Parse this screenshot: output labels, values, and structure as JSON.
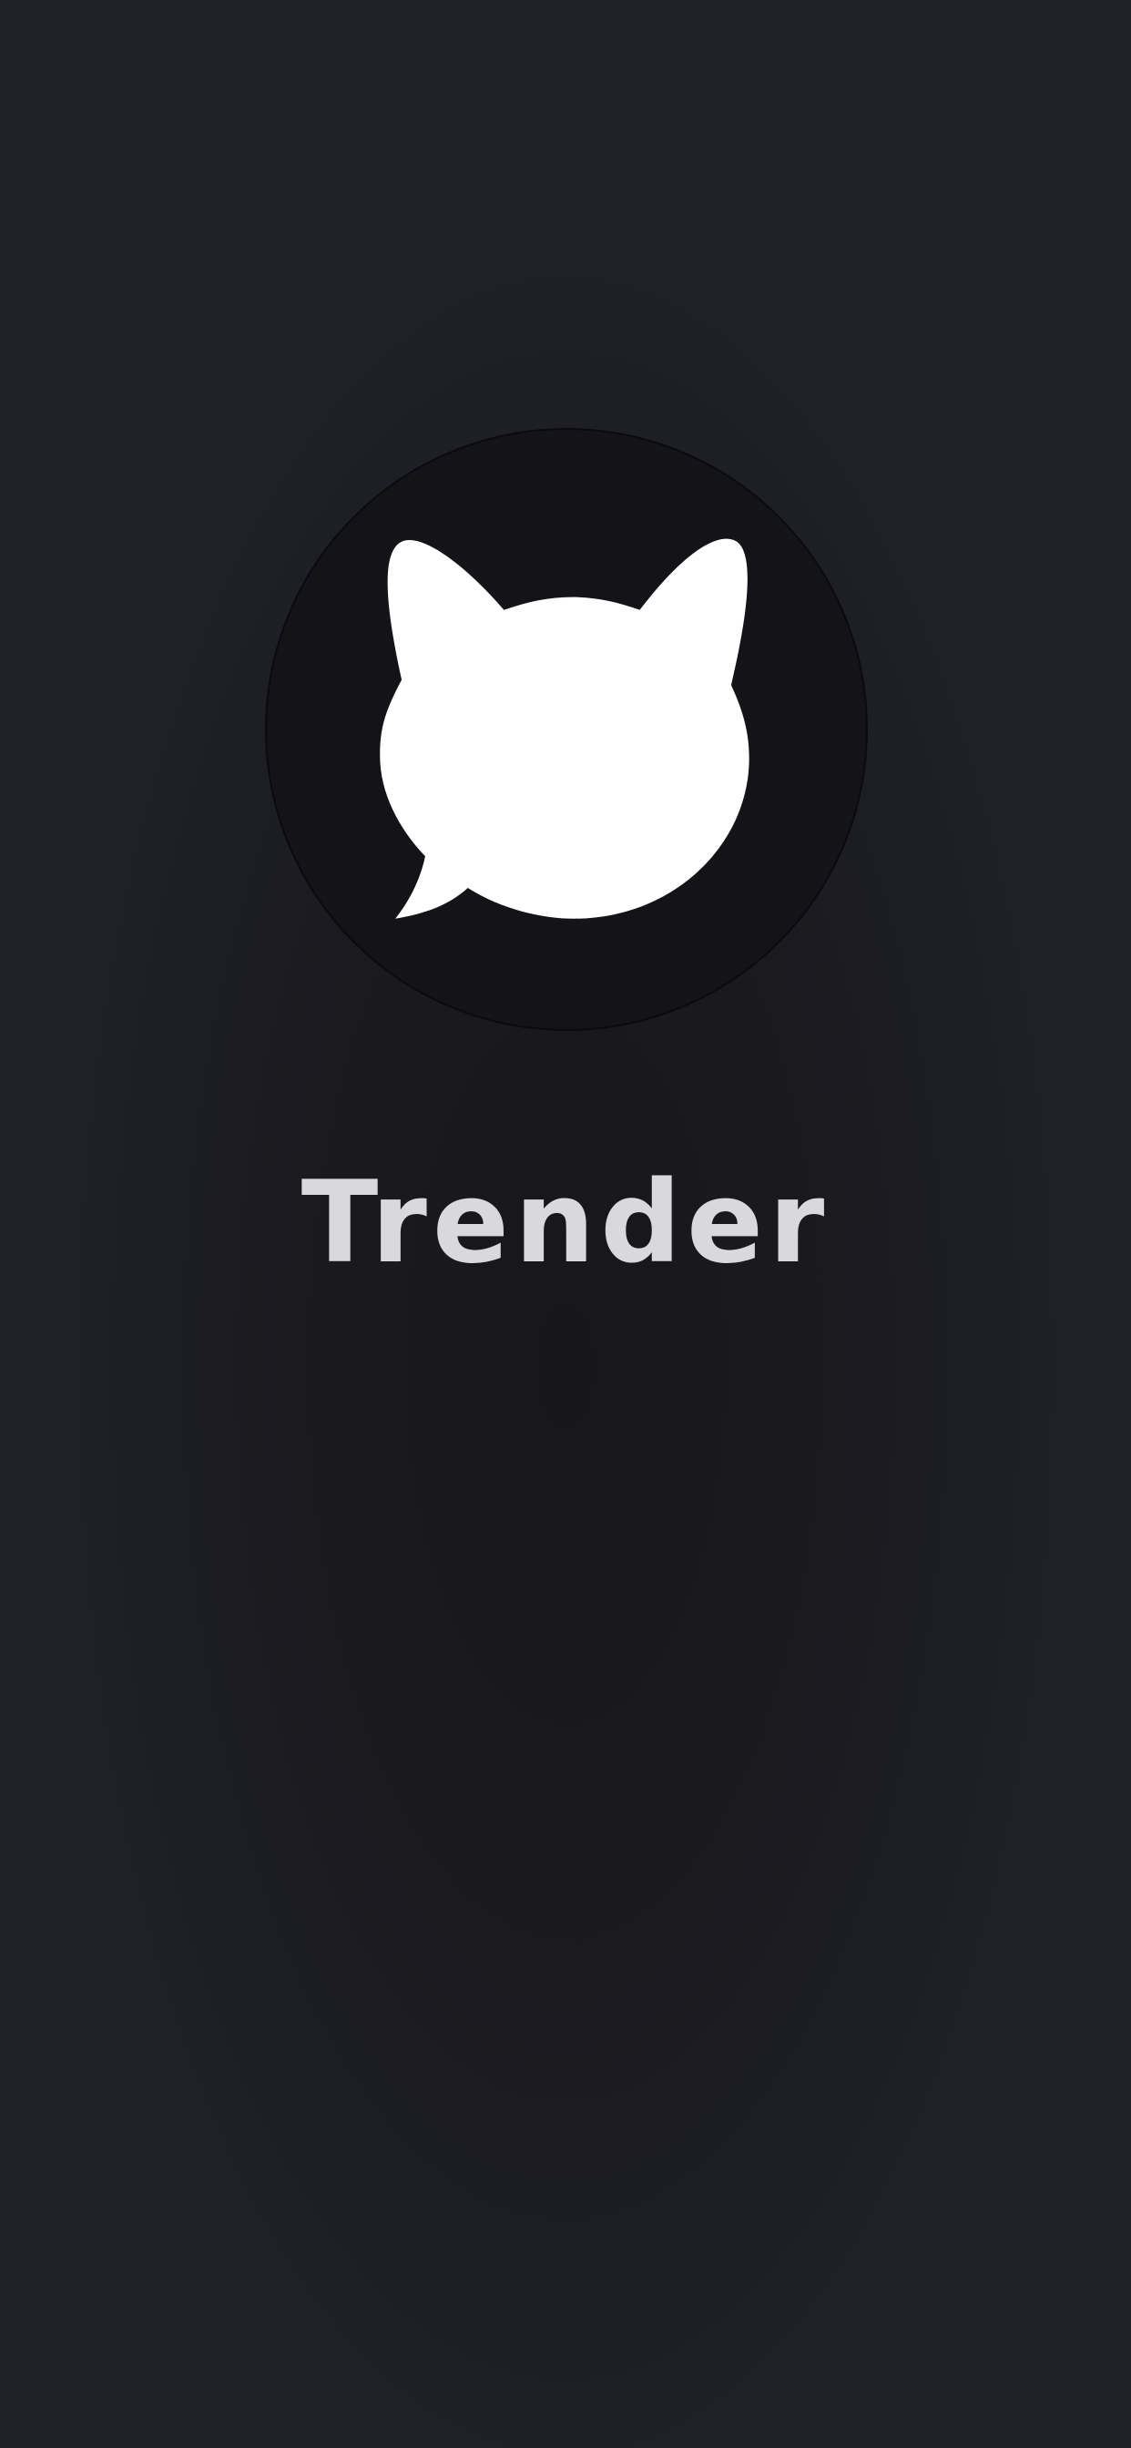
{
  "splash": {
    "app_name": "Trender",
    "logo_icon": "cat-speech-bubble-icon"
  },
  "colors": {
    "background": "#1d1d24",
    "logo_circle": "#131318",
    "logo_glyph": "#ffffff",
    "app_name_text": "#d9d9db"
  }
}
